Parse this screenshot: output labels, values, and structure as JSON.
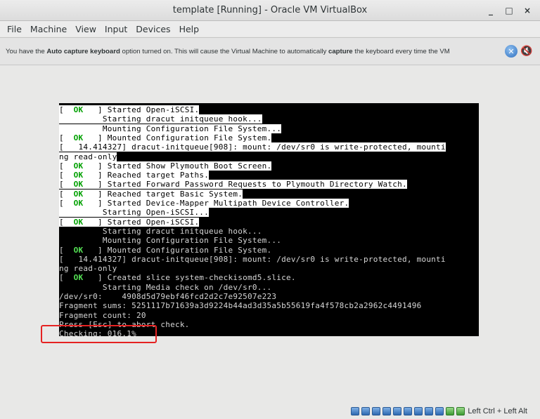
{
  "window": {
    "title": "template [Running] - Oracle VM VirtualBox",
    "minimize": "_",
    "maximize": "□",
    "close": "×"
  },
  "menu": [
    "File",
    "Machine",
    "View",
    "Input",
    "Devices",
    "Help"
  ],
  "notice": {
    "pre": "You have the ",
    "bold1": "Auto capture keyboard",
    "mid": " option turned on. This will cause the Virtual Machine to automatically ",
    "bold2": "capture",
    "post": " the keyboard every time the VM",
    "close_icon": "close-circle-icon",
    "mute_icon": "do-not-show-icon"
  },
  "console": {
    "lines": [
      {
        "ok": true,
        "text": " ] Started Open-iSCSI.",
        "white": true
      },
      {
        "ok": false,
        "text": "         Starting dracut initqueue hook...",
        "white": true
      },
      {
        "ok": false,
        "text": "         Mounting Configuration File System...",
        "white": true
      },
      {
        "ok": true,
        "text": " ] Mounted Configuration File System.",
        "white": true
      },
      {
        "ok": false,
        "text": "[   14.414327] dracut-initqueue[908]: mount: /dev/sr0 is write-protected, mounti",
        "white": true
      },
      {
        "ok": false,
        "text": "ng read-only",
        "white": true
      },
      {
        "ok": true,
        "text": " ] Started Show Plymouth Boot Screen.",
        "white": true
      },
      {
        "ok": true,
        "text": " ] Reached target Paths.",
        "white": true
      },
      {
        "ok": true,
        "text": " ] Started Forward Password Requests to Plymouth Directory Watch.",
        "white": true
      },
      {
        "ok": true,
        "text": " ] Reached target Basic System.",
        "white": true
      },
      {
        "ok": true,
        "text": " ] Started Device-Mapper Multipath Device Controller.",
        "white": true
      },
      {
        "ok": false,
        "text": "         Starting Open-iSCSI...",
        "white": true
      },
      {
        "ok": true,
        "text": " ] Started Open-iSCSI.",
        "white": true
      },
      {
        "ok": false,
        "text": "         Starting dracut initqueue hook...",
        "white": false
      },
      {
        "ok": false,
        "text": "         Mounting Configuration File System...",
        "white": false
      },
      {
        "ok": true,
        "text": " ] Mounted Configuration File System.",
        "white": false
      },
      {
        "ok": false,
        "text": "[   14.414327] dracut-initqueue[908]: mount: /dev/sr0 is write-protected, mounti",
        "white": false
      },
      {
        "ok": false,
        "text": "ng read-only",
        "white": false
      },
      {
        "ok": true,
        "text": " ] Created slice system-checkisomd5.slice.",
        "white": false
      },
      {
        "ok": false,
        "text": "         Starting Media check on /dev/sr0...",
        "white": false
      },
      {
        "ok": false,
        "text": "/dev/sr0:    4908d5d79ebf46fcd2d2c7e92507e223",
        "white": false
      },
      {
        "ok": false,
        "text": "Fragment sums: 5251117b71639a3d9224b44ad3d35a5b55619fa4f578cb2a2962c4491496",
        "white": false
      },
      {
        "ok": false,
        "text": "Fragment count: 20",
        "white": false
      },
      {
        "ok": false,
        "text": "Press [Esc] to abort check.",
        "white": false
      },
      {
        "ok": false,
        "text": "Checking: 016.1%",
        "white": false
      }
    ],
    "ok_label": "  OK  "
  },
  "status": {
    "host_key": "Left Ctrl + Left Alt",
    "icons": [
      "hard-disk-icon",
      "optical-drive-icon",
      "audio-icon",
      "usb-icon",
      "shared-folder-icon",
      "display-icon",
      "video-capture-icon",
      "network-icon",
      "cpu-icon",
      "mouse-icon",
      "keyboard-icon"
    ]
  }
}
